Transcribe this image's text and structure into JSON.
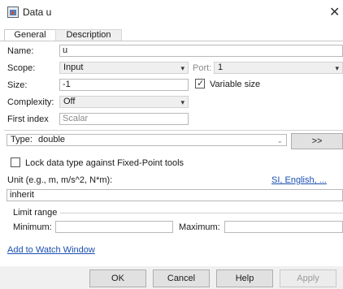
{
  "window": {
    "title": "Data u",
    "close_icon": "close-icon"
  },
  "tabs": [
    {
      "label": "General"
    },
    {
      "label": "Description"
    }
  ],
  "form": {
    "name_label": "Name:",
    "name_value": "u",
    "scope_label": "Scope:",
    "scope_value": "Input",
    "port_label": "Port:",
    "port_value": "1",
    "size_label": "Size:",
    "size_value": "-1",
    "variable_size_label": "Variable size",
    "variable_size_checked": true,
    "complexity_label": "Complexity:",
    "complexity_value": "Off",
    "first_index_label": "First index",
    "first_index_placeholder": "Scalar",
    "type_label": "Type:",
    "type_value": "double",
    "assistant_button_label": ">>",
    "lock_label": "Lock data type against Fixed-Point tools",
    "lock_checked": false,
    "unit_label": "Unit (e.g., m, m/s^2, N*m):",
    "unit_link": "SI, English, ...",
    "unit_value": "inherit",
    "limit_range_label": "Limit range",
    "minimum_label": "Minimum:",
    "minimum_value": "",
    "maximum_label": "Maximum:",
    "maximum_value": ""
  },
  "watch_link": "Add to Watch Window",
  "buttons": {
    "ok": "OK",
    "cancel": "Cancel",
    "help": "Help",
    "apply": "Apply"
  }
}
